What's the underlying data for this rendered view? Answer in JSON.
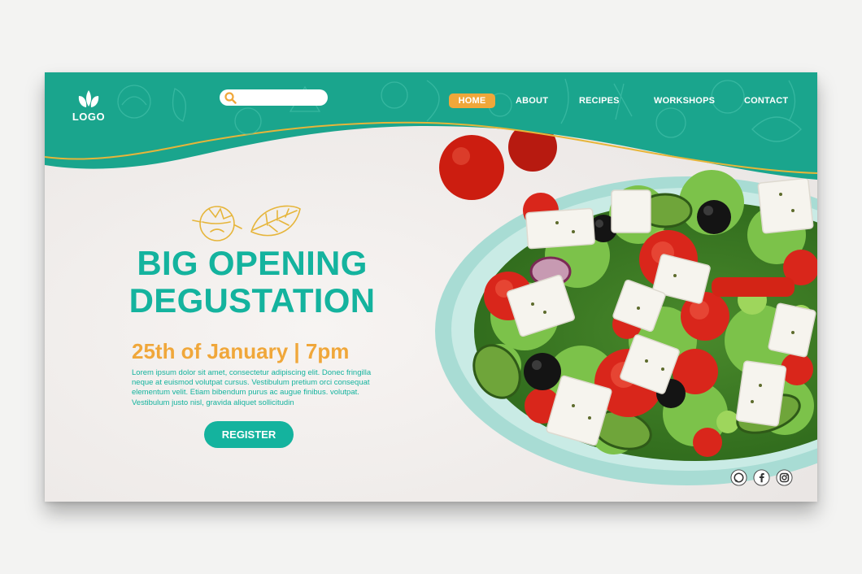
{
  "logo": {
    "text": "LOGO"
  },
  "search": {
    "placeholder": ""
  },
  "nav": {
    "items": [
      {
        "label": "HOME",
        "active": true
      },
      {
        "label": "ABOUT",
        "active": false
      },
      {
        "label": "RECIPES",
        "active": false
      },
      {
        "label": "WORKSHOPS",
        "active": false
      },
      {
        "label": "CONTACT",
        "active": false
      }
    ]
  },
  "hero": {
    "title_line1": "BIG OPENING",
    "title_line2": "DEGUSTATION",
    "date": "25th of January | 7pm",
    "body": "Lorem ipsum dolor sit amet, consectetur adipiscing elit. Donec fringilla neque at euismod volutpat cursus. Vestibulum pretium orci consequat elementum velit. Etiam bibendum purus ac augue finibus. volutpat. Vestibulum justo nisl, gravida aliquet sollicitudin",
    "register_label": "REGISTER"
  },
  "social": {
    "icons": [
      "whatsapp-icon",
      "facebook-icon",
      "instagram-icon"
    ]
  },
  "colors": {
    "header": "#1aa58d",
    "accent": "#14b39e",
    "orange": "#f0a73a",
    "gold_line": "#e6b53a"
  }
}
